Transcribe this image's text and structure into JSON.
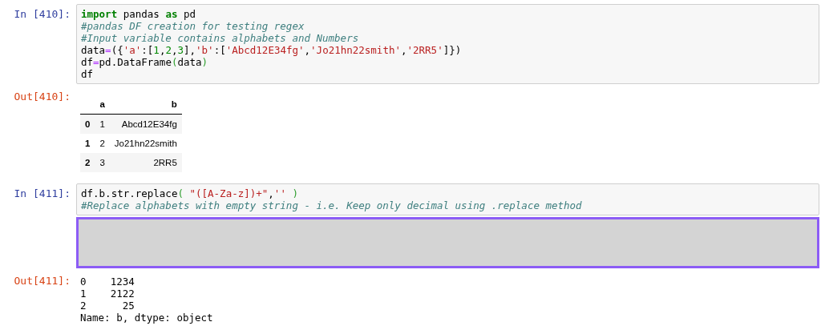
{
  "cells": [
    {
      "prompt": "In [410]:",
      "code": [
        [
          {
            "kind": "kw",
            "text": "import"
          },
          {
            "kind": "plain",
            "text": " pandas "
          },
          {
            "kind": "kw",
            "text": "as"
          },
          {
            "kind": "plain",
            "text": " pd"
          }
        ],
        [
          {
            "kind": "comment",
            "text": "#pandas DF creation for testing regex"
          }
        ],
        [
          {
            "kind": "comment",
            "text": "#Input variable contains alphabets and Numbers"
          }
        ],
        [
          {
            "kind": "plain",
            "text": "data"
          },
          {
            "kind": "op",
            "text": "="
          },
          {
            "kind": "plain",
            "text": "({"
          },
          {
            "kind": "str",
            "text": "'a'"
          },
          {
            "kind": "plain",
            "text": ":["
          },
          {
            "kind": "num",
            "text": "1"
          },
          {
            "kind": "plain",
            "text": ","
          },
          {
            "kind": "num",
            "text": "2"
          },
          {
            "kind": "plain",
            "text": ","
          },
          {
            "kind": "num",
            "text": "3"
          },
          {
            "kind": "plain",
            "text": "],"
          },
          {
            "kind": "str",
            "text": "'b'"
          },
          {
            "kind": "plain",
            "text": ":["
          },
          {
            "kind": "str",
            "text": "'Abcd12E34fg'"
          },
          {
            "kind": "plain",
            "text": ","
          },
          {
            "kind": "str",
            "text": "'Jo21hn22smith'"
          },
          {
            "kind": "plain",
            "text": ","
          },
          {
            "kind": "str",
            "text": "'2RR5'"
          },
          {
            "kind": "plain",
            "text": "]})"
          }
        ],
        [
          {
            "kind": "plain",
            "text": "df"
          },
          {
            "kind": "op",
            "text": "="
          },
          {
            "kind": "plain",
            "text": "pd.DataFrame"
          },
          {
            "kind": "paren",
            "text": "("
          },
          {
            "kind": "plain",
            "text": "data"
          },
          {
            "kind": "paren",
            "text": ")"
          }
        ],
        [
          {
            "kind": "plain",
            "text": "df"
          }
        ]
      ],
      "output": {
        "kind": "table",
        "prompt": "Out[410]:",
        "columns": [
          "a",
          "b"
        ],
        "rows": [
          {
            "index": "0",
            "values": [
              "1",
              "Abcd12E34fg"
            ]
          },
          {
            "index": "1",
            "values": [
              "2",
              "Jo21hn22smith"
            ]
          },
          {
            "index": "2",
            "values": [
              "3",
              "2RR5"
            ]
          }
        ]
      }
    },
    {
      "prompt": "In [411]:",
      "code": [
        [
          {
            "kind": "plain",
            "text": "df.b.str.replace"
          },
          {
            "kind": "paren",
            "text": "( "
          },
          {
            "kind": "str",
            "text": "\"([A-Za-z])+\""
          },
          {
            "kind": "plain",
            "text": ","
          },
          {
            "kind": "str",
            "text": "''"
          },
          {
            "kind": "paren",
            "text": " )"
          }
        ],
        [
          {
            "kind": "comment",
            "text": "#Replace alphabets with empty string - i.e. Keep only decimal using .replace method"
          }
        ]
      ],
      "overlay": {
        "kind": "blank"
      },
      "output": {
        "kind": "text",
        "prompt": "Out[411]:",
        "lines": [
          "0    1234",
          "1    2122",
          "2      25",
          "Name: b, dtype: object"
        ]
      }
    }
  ]
}
